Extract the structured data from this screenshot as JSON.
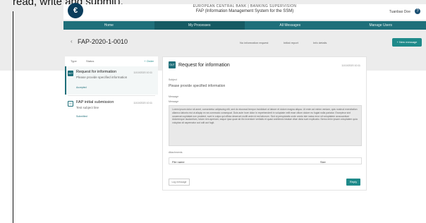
{
  "caption": "read, write and submit).",
  "header": {
    "logo": "€",
    "org": "EUROPEAN CENTRAL BANK | BANKING SUPERVISION",
    "system": "FAP (Information Management System for the SSM)",
    "user": "Tuanbao Doe",
    "help": "?"
  },
  "nav": [
    {
      "label": "Home",
      "active": false
    },
    {
      "label": "My Processes",
      "active": true
    },
    {
      "label": "All Messages",
      "active": false
    },
    {
      "label": "Manage Users",
      "active": false
    }
  ],
  "title_row": {
    "back": "‹",
    "title": "FAP-2020-1-0010",
    "link1": "No information request",
    "link2": "Initial report",
    "link3": "Info details",
    "new_message": "+ New message"
  },
  "list": {
    "type": "Type",
    "status": "Status",
    "order": "+ Order",
    "rows": [
      {
        "badge": "OUT",
        "title": "Request for information",
        "date": "11/10/2020 10:11",
        "subtitle": "Please provide specified information",
        "status": "Accepted"
      },
      {
        "badge": "IN",
        "title": "FAP initial submission",
        "date": "11/10/2020 10:11",
        "subtitle": "Test subject line",
        "status": "Submitted"
      }
    ]
  },
  "detail": {
    "badge": "OUT",
    "title": "Request for information",
    "date": "11/10/2020 10:11",
    "subject_label": "Subject",
    "subject_value": "Please provide specified information",
    "message_label": "Message",
    "message_sublabel": "Message",
    "message_body": "Lorem ipsum dolor sit amet, consectetur adipiscing elit, sed do eiusmod tempor incididunt ut labore et dolore magna aliqua. Ut enim ad minim veniam, quis nostrud exercitation ullamco laboris nisi ut aliquip ex ea commodo consequat. Duis aute irure dolor in reprehenderit in voluptate velit esse cillum dolore eu fugiat nulla pariatur. Excepteur sint occaecat cupidatat non proident, sunt in culpa qui officia deserunt mollit anim id est laborum. Sed ut perspiciatis unde omnis iste natus error sit voluptatem accusantium doloremque laudantium, totam rem aperiam, eaque ipsa quae ab illo inventore veritatis et quasi architecto beatae vitae dicta sunt explicabo. Nemo enim ipsam voluptatem quia voluptas sit aspernatur aut odit aut fugit.",
    "attachments_label": "Attachments",
    "col_filename": "File name",
    "col_size": "Size",
    "left_btn": "Log message",
    "reply_btn": "Reply"
  }
}
